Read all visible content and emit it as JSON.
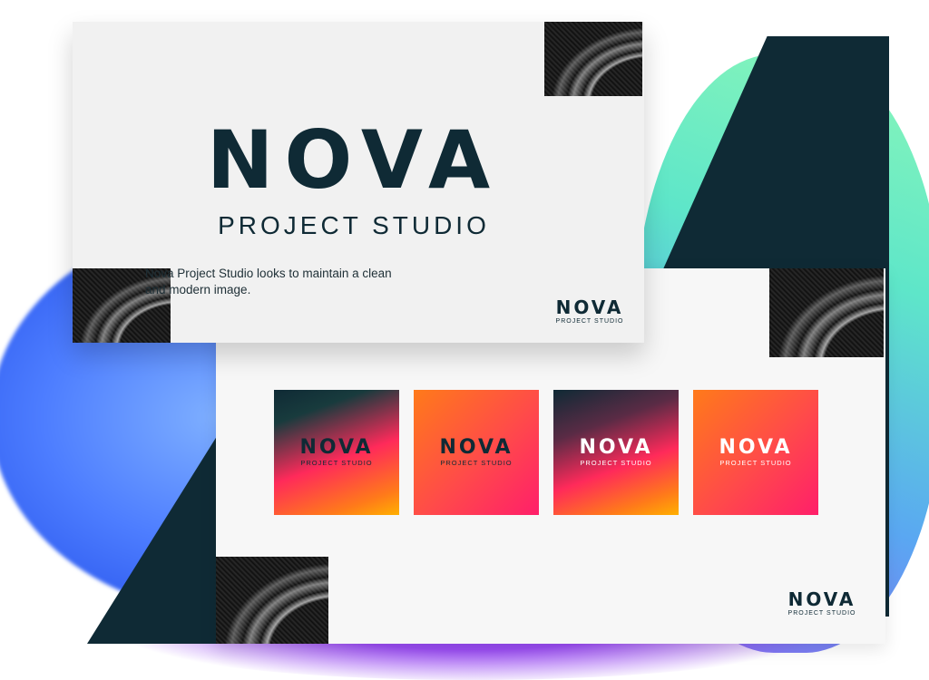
{
  "front_slide": {
    "logo_word": "NOVA",
    "logo_sub": "PROJECT STUDIO",
    "description": "Nova Project Studio looks to maintain a clean and modern image.",
    "corner_logo_word": "NOVA",
    "corner_logo_sub": "PROJECT STUDIO"
  },
  "back_slide": {
    "tiles": [
      {
        "word": "NOVA",
        "sub": "PROJECT STUDIO"
      },
      {
        "word": "NOVA",
        "sub": "PROJECT STUDIO"
      },
      {
        "word": "NOVA",
        "sub": "PROJECT STUDIO"
      },
      {
        "word": "NOVA",
        "sub": "PROJECT STUDIO"
      }
    ],
    "corner_logo_word": "NOVA",
    "corner_logo_sub": "PROJECT STUDIO"
  },
  "colors": {
    "brand_dark": "#0f2a35",
    "gradient_orange": "#ff7a1a",
    "gradient_pink": "#ff1f6a"
  }
}
